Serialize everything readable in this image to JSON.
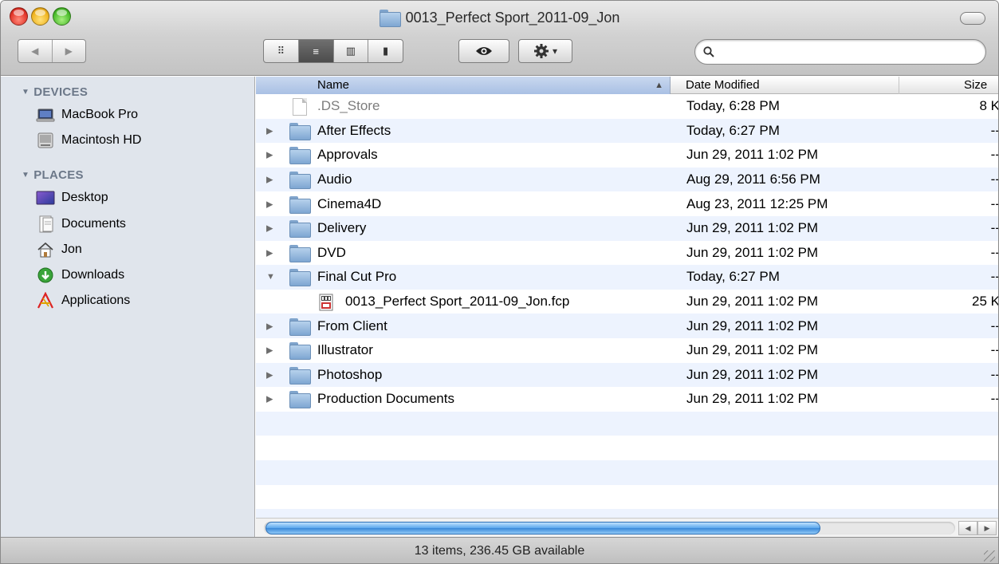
{
  "window": {
    "title": "0013_Perfect Sport_2011-09_Jon"
  },
  "toolbar": {
    "back_icon": "◀",
    "forward_icon": "▶",
    "view_icons": [
      "icon-view-icon",
      "list-view-icon",
      "column-view-icon",
      "coverflow-view-icon"
    ],
    "view_glyphs": [
      "⠿",
      "≡",
      "▥",
      "▮"
    ],
    "quicklook_glyph": "👁",
    "action_glyph": "✲",
    "action_caret": "▾",
    "search_placeholder": ""
  },
  "sidebar": {
    "devices_heading": "DEVICES",
    "places_heading": "PLACES",
    "devices": [
      {
        "label": "MacBook Pro",
        "icon": "laptop-icon"
      },
      {
        "label": "Macintosh HD",
        "icon": "hard-drive-icon"
      }
    ],
    "places": [
      {
        "label": "Desktop",
        "icon": "desktop-icon"
      },
      {
        "label": "Documents",
        "icon": "documents-icon"
      },
      {
        "label": "Jon",
        "icon": "home-icon"
      },
      {
        "label": "Downloads",
        "icon": "downloads-icon"
      },
      {
        "label": "Applications",
        "icon": "applications-icon"
      }
    ]
  },
  "columns": {
    "name": "Name",
    "date": "Date Modified",
    "size": "Size",
    "sort_indicator": "▲"
  },
  "files": [
    {
      "name": ".DS_Store",
      "date": "Today, 6:28 PM",
      "size": "8 K",
      "kind": "file",
      "disclosure": "",
      "dim": true
    },
    {
      "name": "After Effects",
      "date": "Today, 6:27 PM",
      "size": "--",
      "kind": "folder",
      "disclosure": "▶"
    },
    {
      "name": "Approvals",
      "date": "Jun 29, 2011 1:02 PM",
      "size": "--",
      "kind": "folder",
      "disclosure": "▶"
    },
    {
      "name": "Audio",
      "date": "Aug 29, 2011 6:56 PM",
      "size": "--",
      "kind": "folder",
      "disclosure": "▶"
    },
    {
      "name": "Cinema4D",
      "date": "Aug 23, 2011 12:25 PM",
      "size": "--",
      "kind": "folder",
      "disclosure": "▶"
    },
    {
      "name": "Delivery",
      "date": "Jun 29, 2011 1:02 PM",
      "size": "--",
      "kind": "folder",
      "disclosure": "▶"
    },
    {
      "name": "DVD",
      "date": "Jun 29, 2011 1:02 PM",
      "size": "--",
      "kind": "folder",
      "disclosure": "▶"
    },
    {
      "name": "Final Cut Pro",
      "date": "Today, 6:27 PM",
      "size": "--",
      "kind": "folder",
      "disclosure": "▼"
    },
    {
      "name": "0013_Perfect Sport_2011-09_Jon.fcp",
      "date": "Jun 29, 2011 1:02 PM",
      "size": "25 K",
      "kind": "fcp",
      "disclosure": "",
      "indent": true
    },
    {
      "name": "From Client",
      "date": "Jun 29, 2011 1:02 PM",
      "size": "--",
      "kind": "folder",
      "disclosure": "▶"
    },
    {
      "name": "Illustrator",
      "date": "Jun 29, 2011 1:02 PM",
      "size": "--",
      "kind": "folder",
      "disclosure": "▶"
    },
    {
      "name": "Photoshop",
      "date": "Jun 29, 2011 1:02 PM",
      "size": "--",
      "kind": "folder",
      "disclosure": "▶"
    },
    {
      "name": "Production Documents",
      "date": "Jun 29, 2011 1:02 PM",
      "size": "--",
      "kind": "folder",
      "disclosure": "▶"
    }
  ],
  "scrollbar": {
    "left_arrow": "◀",
    "right_arrow": "▶"
  },
  "status": {
    "text": "13 items, 236.45 GB available"
  },
  "colors": {
    "alt_row": "#edf3fe",
    "sidebar_bg": "#e0e5ec",
    "sidebar_heading": "#6c7889"
  }
}
